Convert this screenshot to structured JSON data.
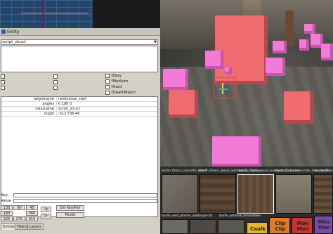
{
  "window": {
    "title": "Entity"
  },
  "entity": {
    "class_value": "script_struct",
    "spawnflags": {
      "easy": "!Easy",
      "medium": "!Medium",
      "hard": "!Hard",
      "deathmatch": "!DeathMatch"
    },
    "keyvalues": [
      {
        "key": "targetname",
        "value": "randomize_start"
      },
      {
        "key": "angles",
        "value": "0 180 0"
      },
      {
        "key": "classname",
        "value": "script_struct"
      },
      {
        "key": "origin",
        "value": "-512 536 40"
      }
    ],
    "key_label": "Key",
    "value_label": "Value",
    "angles": [
      "135",
      "90",
      "45",
      "180",
      "360",
      "225",
      "270",
      "315"
    ],
    "up_label": "Up",
    "dn_label": "Dn",
    "del_label": "Del Key/Pair",
    "model_label": "Model"
  },
  "tabs": [
    "Entities",
    "Filters",
    "Layers"
  ],
  "textures": {
    "names": [
      "barlin_floors_concrete_blue4",
      "barlin_floors_wood_bambooc2_cbadey",
      "barlin_floors_wood_bambooc2_cbadey",
      "barlin_floors_concrete_tube_splata",
      "barlin_floors_wood"
    ],
    "row2_names": [
      "barlin_wall_plaster_wallpaper18",
      "barlin_window_breakables"
    ],
    "caulk_label": "Caulk",
    "clip_labels": [
      "Clip",
      "Clip"
    ],
    "mon_labels": [
      "Mon",
      "Mon"
    ],
    "miss_labels": [
      "Miss",
      "Mon"
    ]
  },
  "colors": {
    "accent_pink": "#f27bd8",
    "selected_red": "#ee6b70"
  }
}
